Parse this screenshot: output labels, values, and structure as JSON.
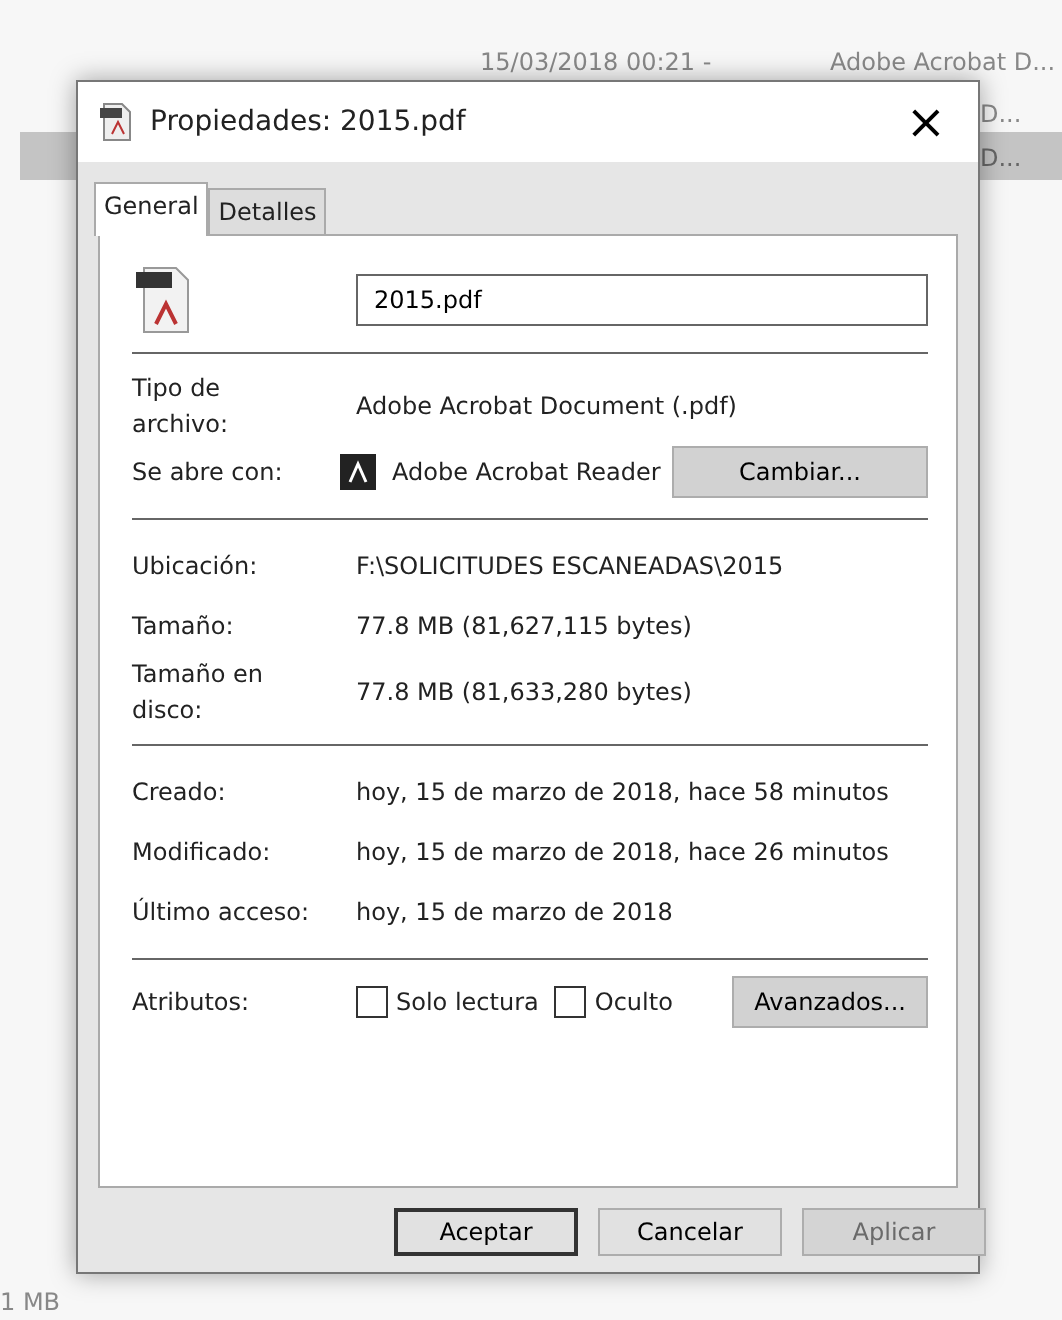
{
  "background_list": [
    {
      "text": "15/03/2018 00:21 -",
      "kind": "date"
    },
    {
      "text": "Adobe Acrobat D...",
      "kind": "type"
    },
    {
      "text": "D...",
      "kind": "type"
    },
    {
      "text": "D...",
      "kind": "type_selected"
    },
    {
      "text": "1 MB",
      "kind": "size"
    }
  ],
  "window": {
    "title": "Propiedades: 2015.pdf",
    "close": "×"
  },
  "tabs": [
    {
      "label": "General",
      "selected": true
    },
    {
      "label": "Detalles",
      "selected": false
    }
  ],
  "file_name": {
    "value": "2015.pdf"
  },
  "sections": [
    [
      {
        "label": "Tipo de archivo:",
        "value": "Adobe Acrobat Document (.pdf)",
        "kind": "text"
      },
      {
        "label": "Se abre con:",
        "value": "Adobe Acrobat Reader",
        "kind": "app",
        "button": "Cambiar..."
      }
    ],
    [
      {
        "label": "Ubicación:",
        "value": "F:\\SOLICITUDES ESCANEADAS\\2015",
        "kind": "text"
      },
      {
        "label": "Tamaño:",
        "value": "77.8 MB (81,627,115 bytes)",
        "kind": "text"
      },
      {
        "label": "Tamaño en disco:",
        "value": "77.8 MB (81,633,280 bytes)",
        "kind": "text"
      }
    ],
    [
      {
        "label": "Creado:",
        "value": "hoy, 15 de marzo de 2018, hace 58 minutos",
        "kind": "text"
      },
      {
        "label": "Modificado:",
        "value": "hoy, 15 de marzo de 2018, hace 26 minutos",
        "kind": "text"
      },
      {
        "label": "Último acceso:",
        "value": "hoy, 15 de marzo de 2018",
        "kind": "text"
      }
    ]
  ],
  "attributes": {
    "label": "Atributos:",
    "checkboxes": [
      {
        "label": "Solo lectura",
        "checked": false
      },
      {
        "label": "Oculto",
        "checked": false
      }
    ],
    "button": "Avanzados..."
  },
  "buttons": [
    {
      "label": "Aceptar",
      "default": true,
      "disabled": false
    },
    {
      "label": "Cancelar",
      "default": false,
      "disabled": false
    },
    {
      "label": "Aplicar",
      "default": false,
      "disabled": true
    }
  ]
}
